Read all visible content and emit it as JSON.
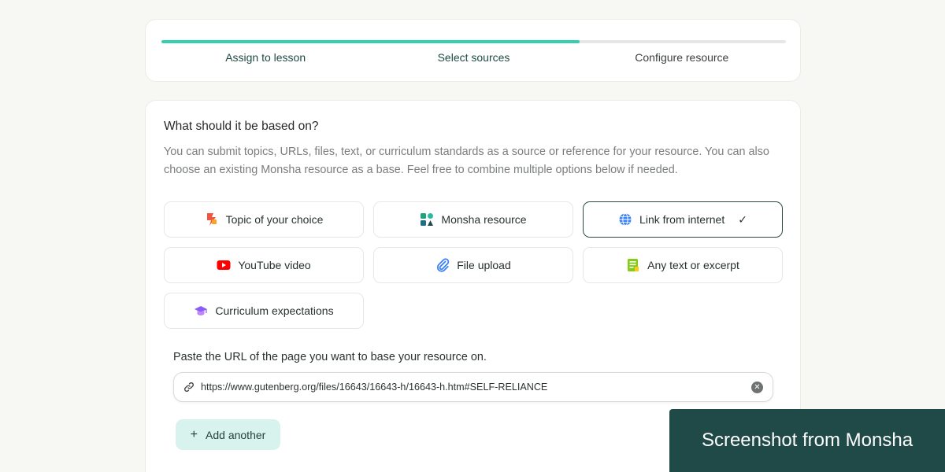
{
  "stepper": {
    "progress": 0.67,
    "steps": [
      {
        "label": "Assign to lesson",
        "state": "complete"
      },
      {
        "label": "Select sources",
        "state": "current"
      },
      {
        "label": "Configure resource",
        "state": "upcoming"
      }
    ]
  },
  "source": {
    "heading": "What should it be based on?",
    "description": "You can submit topics, URLs, files, text, or curriculum standards as a source or reference for your resource. You can also choose an existing Monsha resource as a base. Feel free to combine multiple options below if needed.",
    "options": [
      {
        "label": "Topic of your choice",
        "icon": "topic-icon",
        "selected": false
      },
      {
        "label": "Monsha resource",
        "icon": "monsha-icon",
        "selected": false
      },
      {
        "label": "Link from internet",
        "icon": "globe-icon",
        "selected": true
      },
      {
        "label": "YouTube video",
        "icon": "youtube-icon",
        "selected": false
      },
      {
        "label": "File upload",
        "icon": "paperclip-icon",
        "selected": false
      },
      {
        "label": "Any text or excerpt",
        "icon": "text-icon",
        "selected": false
      },
      {
        "label": "Curriculum expectations",
        "icon": "graduation-cap-icon",
        "selected": false
      }
    ],
    "url_label": "Paste the URL of the page you want to base your resource on.",
    "url_value": "https://www.gutenberg.org/files/16643/16643-h/16643-h.htm#SELF-RELIANCE",
    "add_another_label": "Add another"
  },
  "banner": {
    "text": "Screenshot from Monsha"
  },
  "colors": {
    "accent": "#34cfb0",
    "banner_bg": "#1f4a47",
    "selected_border": "#2e4a47"
  }
}
